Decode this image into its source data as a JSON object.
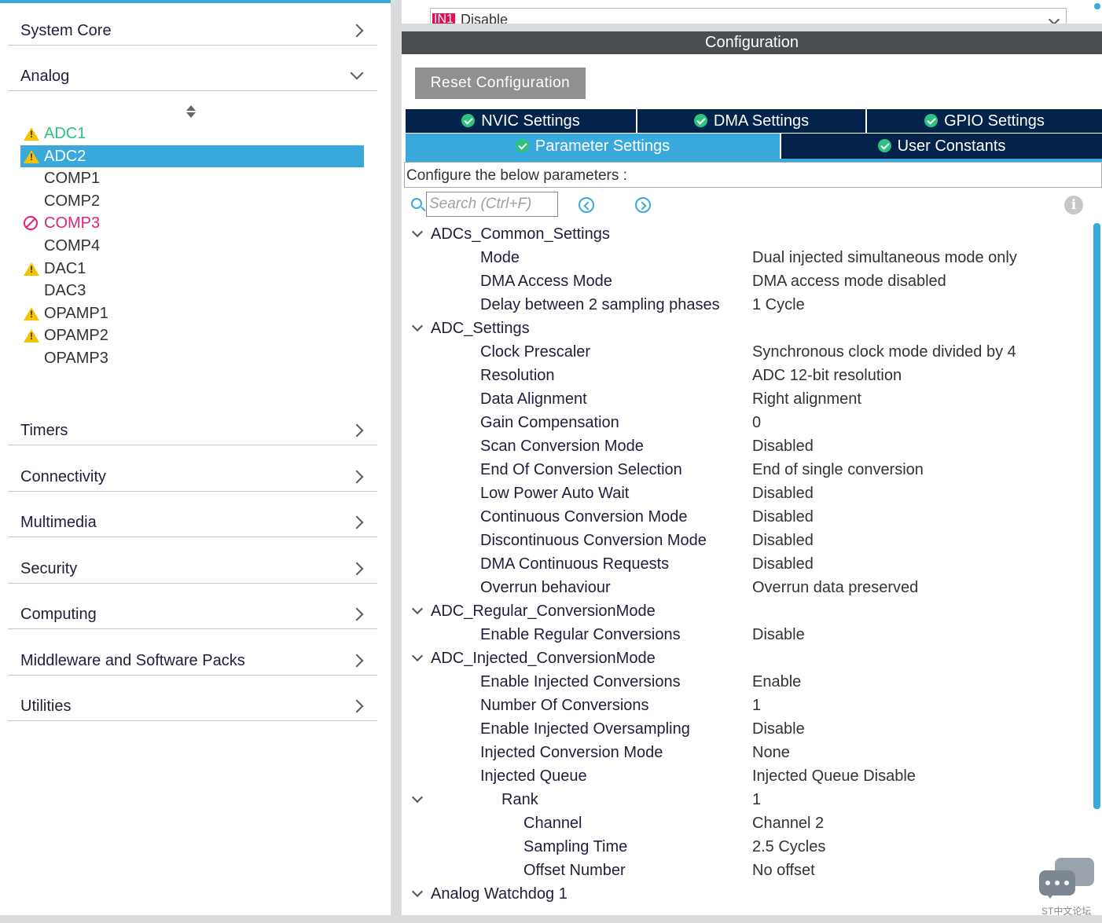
{
  "sidebar": {
    "categories_top": [
      {
        "label": "System Core",
        "expanded": false
      },
      {
        "label": "Analog",
        "expanded": true
      }
    ],
    "peripherals": [
      {
        "name": "ADC1",
        "status": "warning",
        "color": "#2ec27e",
        "selected": false
      },
      {
        "name": "ADC2",
        "status": "warning",
        "color": "#ffffff",
        "selected": true
      },
      {
        "name": "COMP1",
        "status": "none",
        "color": "#333333",
        "selected": false
      },
      {
        "name": "COMP2",
        "status": "none",
        "color": "#333333",
        "selected": false
      },
      {
        "name": "COMP3",
        "status": "blocked",
        "color": "#e0207f",
        "selected": false
      },
      {
        "name": "COMP4",
        "status": "none",
        "color": "#333333",
        "selected": false
      },
      {
        "name": "DAC1",
        "status": "warning",
        "color": "#333333",
        "selected": false
      },
      {
        "name": "DAC3",
        "status": "none",
        "color": "#333333",
        "selected": false
      },
      {
        "name": "OPAMP1",
        "status": "warning",
        "color": "#333333",
        "selected": false
      },
      {
        "name": "OPAMP2",
        "status": "warning",
        "color": "#333333",
        "selected": false
      },
      {
        "name": "OPAMP3",
        "status": "none",
        "color": "#333333",
        "selected": false
      }
    ],
    "categories_bottom": [
      {
        "label": "Timers"
      },
      {
        "label": "Connectivity"
      },
      {
        "label": "Multimedia"
      },
      {
        "label": "Security"
      },
      {
        "label": "Computing"
      },
      {
        "label": "Middleware and Software Packs"
      },
      {
        "label": "Utilities"
      }
    ]
  },
  "mode": {
    "pin_label": "IN1",
    "value": "Disable"
  },
  "config": {
    "header": "Configuration",
    "reset_label": "Reset Configuration",
    "tabs_row1": [
      {
        "label": "NVIC Settings",
        "active": false
      },
      {
        "label": "DMA Settings",
        "active": false
      },
      {
        "label": "GPIO Settings",
        "active": false
      }
    ],
    "tabs_row2": [
      {
        "label": "Parameter Settings",
        "active": true
      },
      {
        "label": "User Constants",
        "active": false
      }
    ],
    "params_label": "Configure the below parameters :",
    "search_placeholder": "Search (Ctrl+F)",
    "info_symbol": "i"
  },
  "params": [
    {
      "level": 0,
      "label": "ADCs_Common_Settings",
      "toggle": true
    },
    {
      "level": 1,
      "label": "Mode",
      "value": "Dual injected simultaneous mode only"
    },
    {
      "level": 1,
      "label": "DMA Access Mode",
      "value": "DMA access mode disabled"
    },
    {
      "level": 1,
      "label": "Delay between 2 sampling phases",
      "value": "1 Cycle"
    },
    {
      "level": 0,
      "label": "ADC_Settings",
      "toggle": true
    },
    {
      "level": 1,
      "label": "Clock Prescaler",
      "value": "Synchronous clock mode divided by 4"
    },
    {
      "level": 1,
      "label": "Resolution",
      "value": "ADC 12-bit resolution"
    },
    {
      "level": 1,
      "label": "Data Alignment",
      "value": "Right alignment"
    },
    {
      "level": 1,
      "label": "Gain Compensation",
      "value": "0"
    },
    {
      "level": 1,
      "label": "Scan Conversion Mode",
      "value": "Disabled"
    },
    {
      "level": 1,
      "label": "End Of Conversion Selection",
      "value": "End of single conversion"
    },
    {
      "level": 1,
      "label": "Low Power Auto Wait",
      "value": "Disabled"
    },
    {
      "level": 1,
      "label": "Continuous Conversion Mode",
      "value": "Disabled"
    },
    {
      "level": 1,
      "label": "Discontinuous Conversion Mode",
      "value": "Disabled"
    },
    {
      "level": 1,
      "label": "DMA Continuous Requests",
      "value": "Disabled"
    },
    {
      "level": 1,
      "label": "Overrun behaviour",
      "value": "Overrun data preserved"
    },
    {
      "level": 0,
      "label": "ADC_Regular_ConversionMode",
      "toggle": true
    },
    {
      "level": 1,
      "label": "Enable Regular Conversions",
      "value": "Disable"
    },
    {
      "level": 0,
      "label": "ADC_Injected_ConversionMode",
      "toggle": true
    },
    {
      "level": 1,
      "label": "Enable Injected Conversions",
      "value": "Enable"
    },
    {
      "level": 1,
      "label": "Number Of Conversions",
      "value": "1"
    },
    {
      "level": 1,
      "label": "Enable Injected Oversampling",
      "value": "Disable"
    },
    {
      "level": 1,
      "label": "Injected Conversion Mode",
      "value": "None"
    },
    {
      "level": 1,
      "label": "Injected Queue",
      "value": "Injected Queue Disable"
    },
    {
      "level": 2,
      "label": "Rank",
      "value": "1",
      "toggle": true
    },
    {
      "level": 3,
      "label": "Channel",
      "value": "Channel 2"
    },
    {
      "level": 3,
      "label": "Sampling Time",
      "value": "2.5 Cycles"
    },
    {
      "level": 3,
      "label": "Offset Number",
      "value": "No offset"
    },
    {
      "level": 0,
      "label": "Analog Watchdog 1",
      "toggle": true
    }
  ],
  "watermark": "ST中文论坛",
  "colors": {
    "accent": "#39a9dc",
    "tab_dark": "#03234b",
    "header_dark": "#4a4d52",
    "warning": "#f5c400",
    "blocked": "#e0207f",
    "ok": "#2ec27e"
  }
}
